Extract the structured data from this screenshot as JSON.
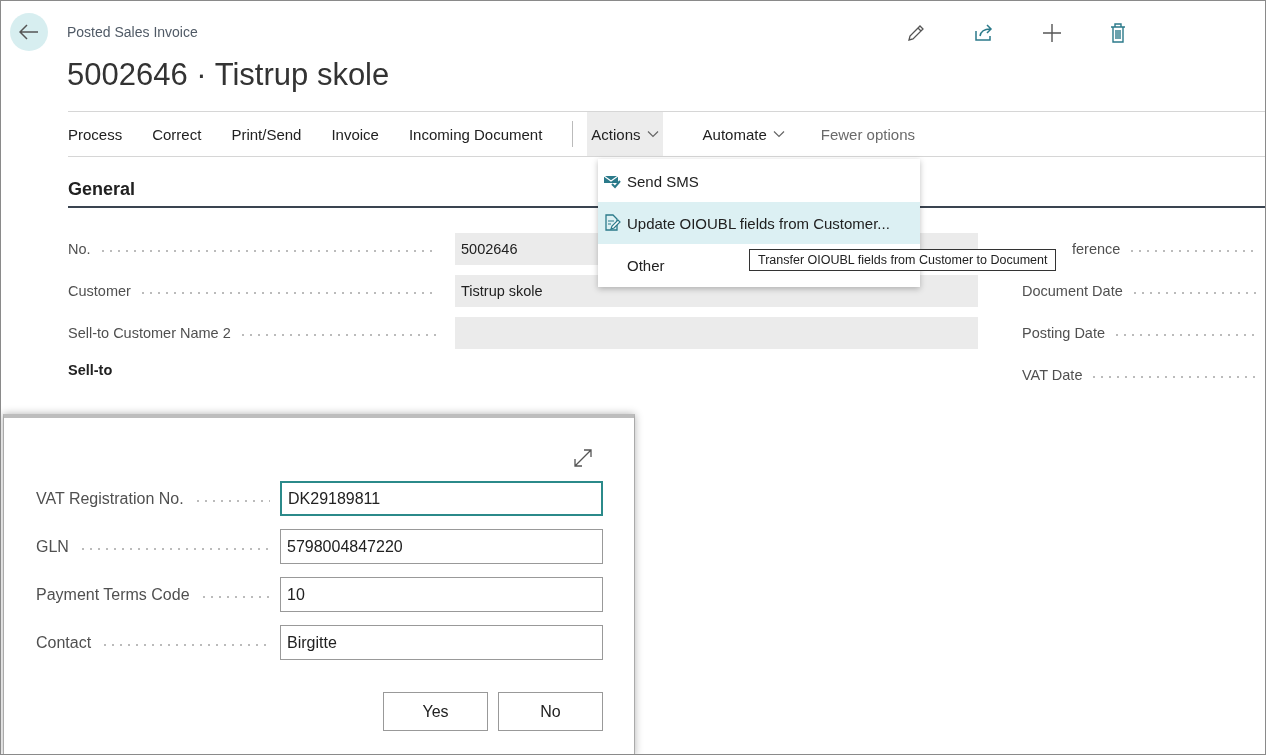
{
  "header": {
    "caption": "Posted Sales Invoice",
    "title": "5002646 · Tistrup skole"
  },
  "action_bar": {
    "items": [
      {
        "label": "Process",
        "kind": "plain"
      },
      {
        "label": "Correct",
        "kind": "plain"
      },
      {
        "label": "Print/Send",
        "kind": "plain"
      },
      {
        "label": "Invoice",
        "kind": "plain"
      },
      {
        "label": "Incoming Document",
        "kind": "plain"
      },
      {
        "label": "Actions",
        "kind": "menu",
        "expanded": true
      },
      {
        "label": "Automate",
        "kind": "menu",
        "expanded": false
      },
      {
        "label": "Fewer options",
        "kind": "muted"
      }
    ]
  },
  "menu": {
    "items": [
      {
        "label": "Send SMS",
        "kind": "mail",
        "highlighted": false
      },
      {
        "label": "Update OIOUBL fields from Customer...",
        "kind": "edit",
        "highlighted": true
      },
      {
        "label": "Other",
        "kind": "plain",
        "highlighted": false
      }
    ]
  },
  "tooltip": "Transfer OIOUBL fields from Customer to Document",
  "general": {
    "title": "General",
    "left_fields": [
      {
        "label": "No.",
        "value": "5002646"
      },
      {
        "label": "Customer",
        "value": "Tistrup skole"
      },
      {
        "label": "Sell-to Customer Name 2"
      }
    ],
    "subheading": "Sell-to",
    "right_fields": [
      {
        "label": "ference"
      },
      {
        "label": "Document Date"
      },
      {
        "label": "Posting Date"
      },
      {
        "label": "VAT Date"
      }
    ]
  },
  "dialog": {
    "fields": [
      {
        "label": "VAT Registration No.",
        "value": "DK29189811",
        "focused": true
      },
      {
        "label": "GLN",
        "value": "5798004847220",
        "focused": false
      },
      {
        "label": "Payment Terms Code",
        "value": "10",
        "focused": false
      },
      {
        "label": "Contact",
        "value": "Birgitte",
        "focused": false
      }
    ],
    "buttons": [
      "Yes",
      "No"
    ]
  }
}
